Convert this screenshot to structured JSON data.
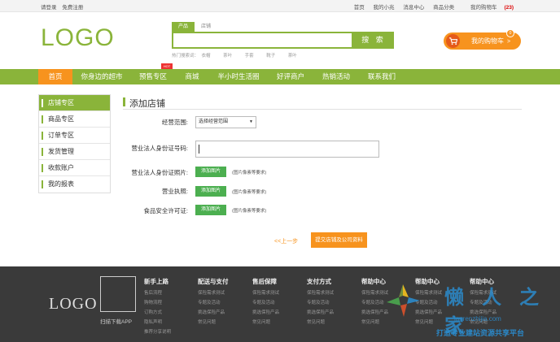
{
  "topbar": {
    "login": "请登录",
    "register": "免费注册",
    "links": [
      "首页",
      "我的小兆",
      "消息中心",
      "商品分类"
    ],
    "cart_label": "我的购物车",
    "cart_count": "(23)"
  },
  "header": {
    "logo": "LOGO",
    "search_tabs": [
      "产品",
      "店铺"
    ],
    "search_button": "搜 索",
    "hot_words_label": "热门搜索词：",
    "hot_words": [
      "衣帽",
      "茶叶",
      "手套",
      "靴子",
      "茶叶"
    ],
    "cart_label": "我的购物车",
    "cart_badge": "0",
    "cart_arrow": ">",
    "cart_icon": "cart-icon"
  },
  "nav": {
    "items": [
      "首页",
      "你身边的超市",
      "预售专区",
      "商城",
      "半小时生活圈",
      "好评商户",
      "热销活动",
      "联系我们"
    ],
    "hot_tag": "HOT",
    "active_color": "#f7931e",
    "bar_color": "#8ab43a"
  },
  "sidebar": {
    "items": [
      "店铺专区",
      "商品专区",
      "订单专区",
      "发货管理",
      "收款账户",
      "我的报表"
    ]
  },
  "form": {
    "title": "添加店铺",
    "scope_label": "经营范围:",
    "scope_value": "选择经营范围",
    "id_number_label": "营业法人身份证号码:",
    "id_photo_label": "营业法人身份证照片:",
    "license_label": "营业执照:",
    "food_label": "食品安全许可证:",
    "add_image": "添加图片",
    "hint": "(图片像素等要求)",
    "prev": "<<上一步",
    "submit": "提交店铺及公司资料"
  },
  "footer": {
    "logo": "LOGO",
    "qr_label": "扫描下载APP",
    "columns": [
      {
        "title": "新手上路",
        "links": [
          "售后流程",
          "购物流程",
          "订购方式",
          "隐私声明",
          "推荐分享说明"
        ]
      },
      {
        "title": "配送与支付",
        "links": [
          "保险需求测试",
          "专题及活动",
          "挑选保险产品",
          "常见问题"
        ]
      },
      {
        "title": "售后保障",
        "links": [
          "保险需求测试",
          "专题及活动",
          "挑选保险产品",
          "常见问题"
        ]
      },
      {
        "title": "支付方式",
        "links": [
          "保险需求测试",
          "专题及活动",
          "挑选保险产品",
          "常见问题"
        ]
      },
      {
        "title": "帮助中心",
        "links": [
          "保险需求测试",
          "专题及活动",
          "挑选保险产品",
          "常见问题"
        ]
      },
      {
        "title": "帮助中心",
        "links": [
          "保险需求测试",
          "专题及活动",
          "挑选保险产品",
          "常见问题"
        ]
      },
      {
        "title": "帮助中心",
        "links": [
          "保险需求测试",
          "专题及活动",
          "挑选保险产品",
          "常见问题"
        ]
      }
    ]
  },
  "watermark": {
    "text": "懒人之家",
    "url": "lanrenzhijia.com",
    "slogan": "打造专业建站资源共享平台"
  }
}
